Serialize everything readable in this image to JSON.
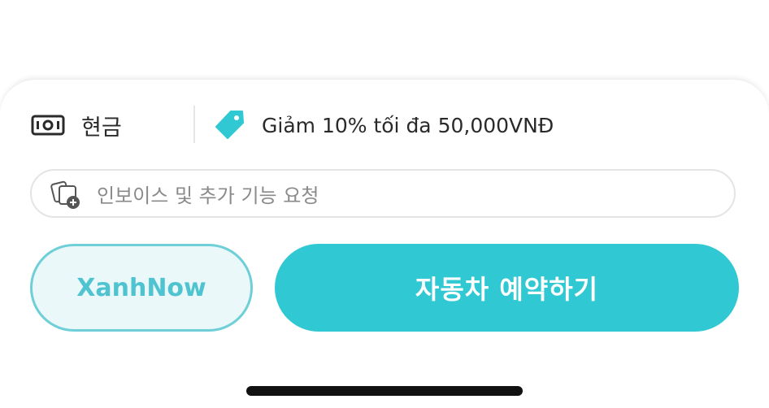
{
  "payment": {
    "method_label": "현금",
    "method_icon": "cash-icon",
    "promo_label": "Giảm 10% tối đa 50,000VNĐ",
    "promo_icon": "tag-icon"
  },
  "request": {
    "placeholder": "인보이스 및 추가 기능 요청",
    "icon": "add-photo-icon"
  },
  "actions": {
    "secondary_label": "XanhNow",
    "primary_label": "자동차 예약하기"
  },
  "colors": {
    "accent": "#30c8d3",
    "accent_light": "#ebf8fa",
    "accent_border": "#6fcfd8",
    "text": "#2a2a2a",
    "placeholder": "#8a8a8a"
  }
}
